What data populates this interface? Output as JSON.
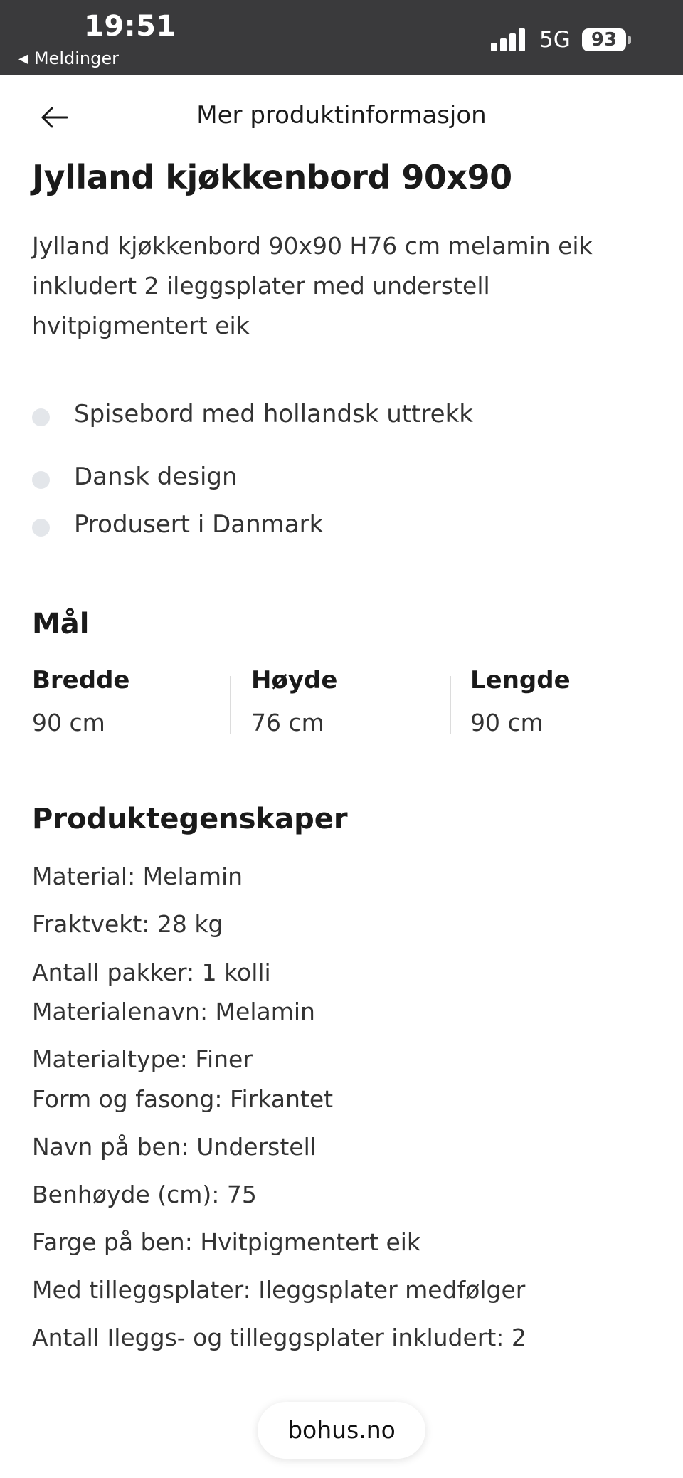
{
  "status_bar": {
    "time": "19:51",
    "back_app": "Meldinger",
    "network": "5G",
    "battery": "93"
  },
  "header": {
    "title": "Mer produktinformasjon"
  },
  "product": {
    "title": "Jylland kjøkkenbord 90x90",
    "description": "Jylland kjøkkenbord 90x90 H76 cm melamin eik inkludert 2 ileggsplater med understell hvitpigmentert eik",
    "features": [
      "Spisebord med hollandsk uttrekk",
      "Dansk design",
      "Produsert i Danmark"
    ]
  },
  "dimensions": {
    "heading": "Mål",
    "items": [
      {
        "label": "Bredde",
        "value": "90 cm"
      },
      {
        "label": "Høyde",
        "value": "76 cm"
      },
      {
        "label": "Lengde",
        "value": "90 cm"
      }
    ]
  },
  "properties": {
    "heading": "Produktegenskaper",
    "items": [
      "Material: Melamin",
      "Fraktvekt: 28 kg",
      "Antall pakker: 1 kolli",
      "Materialenavn: Melamin",
      "Materialtype: Finer",
      "Form og fasong: Firkantet",
      "Navn på ben: Understell",
      "Benhøyde (cm): 75",
      "Farge på ben: Hvitpigmentert eik",
      "Med tilleggsplater: Ileggsplater medfølger",
      "Antall Ileggs- og tilleggsplater inkludert: 2"
    ]
  },
  "browser": {
    "url": "bohus.no"
  },
  "colors": {
    "status_bar": "#3a3a3c",
    "bullet": "#e3e6ea",
    "text": "#1f1f1f"
  }
}
